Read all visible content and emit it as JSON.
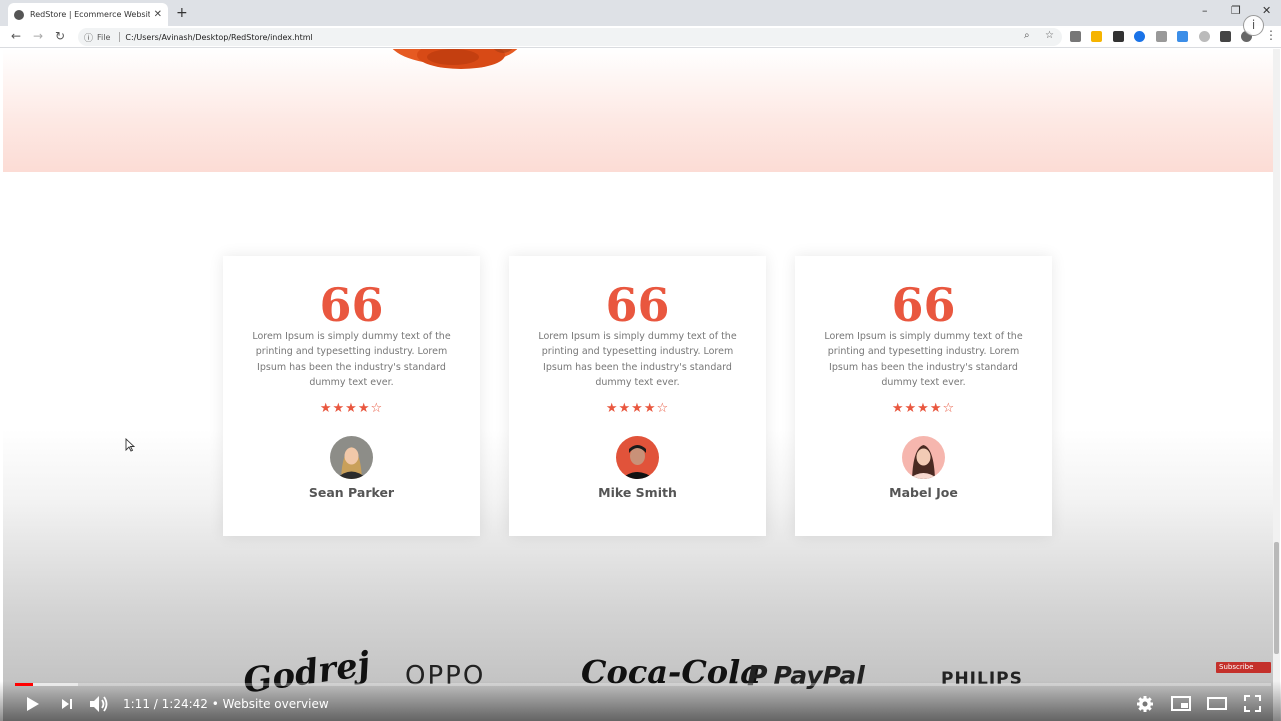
{
  "browser": {
    "tab_title": "RedStore | Ecommerce Website D",
    "tab_close": "✕",
    "new_tab": "+",
    "file_label": "File",
    "url": "C:/Users/Avinash/Desktop/RedStore/index.html",
    "window_controls": [
      "–",
      "❐",
      "✕"
    ]
  },
  "testimonials": [
    {
      "text": "Lorem Ipsum is simply dummy text of the printing and typesetting industry. Lorem Ipsum has been the industry's standard dummy text ever.",
      "rating": 4,
      "rating_max": 5,
      "stars": "★★★★☆",
      "name": "Sean Parker"
    },
    {
      "text": "Lorem Ipsum is simply dummy text of the printing and typesetting industry. Lorem Ipsum has been the industry's standard dummy text ever.",
      "rating": 4,
      "rating_max": 5,
      "stars": "★★★★☆",
      "name": "Mike Smith"
    },
    {
      "text": "Lorem Ipsum is simply dummy text of the printing and typesetting industry. Lorem Ipsum has been the industry's standard dummy text ever.",
      "rating": 4,
      "rating_max": 5,
      "stars": "★★★★☆",
      "name": "Mabel Joe"
    }
  ],
  "quote_mark": "66",
  "brands": [
    "Godrej",
    "OPPO",
    "Coca-Cola",
    "PayPal",
    "PHILIPS"
  ],
  "video": {
    "subscribe_label": "Subscribe",
    "current_time": "1:11",
    "duration": "1:24:42",
    "chapter": "Website overview",
    "progress_fraction": 0.014
  },
  "colors": {
    "accent": "#e9573f",
    "youtube_red": "#ff0000",
    "subscribe_red": "#c4302b"
  }
}
